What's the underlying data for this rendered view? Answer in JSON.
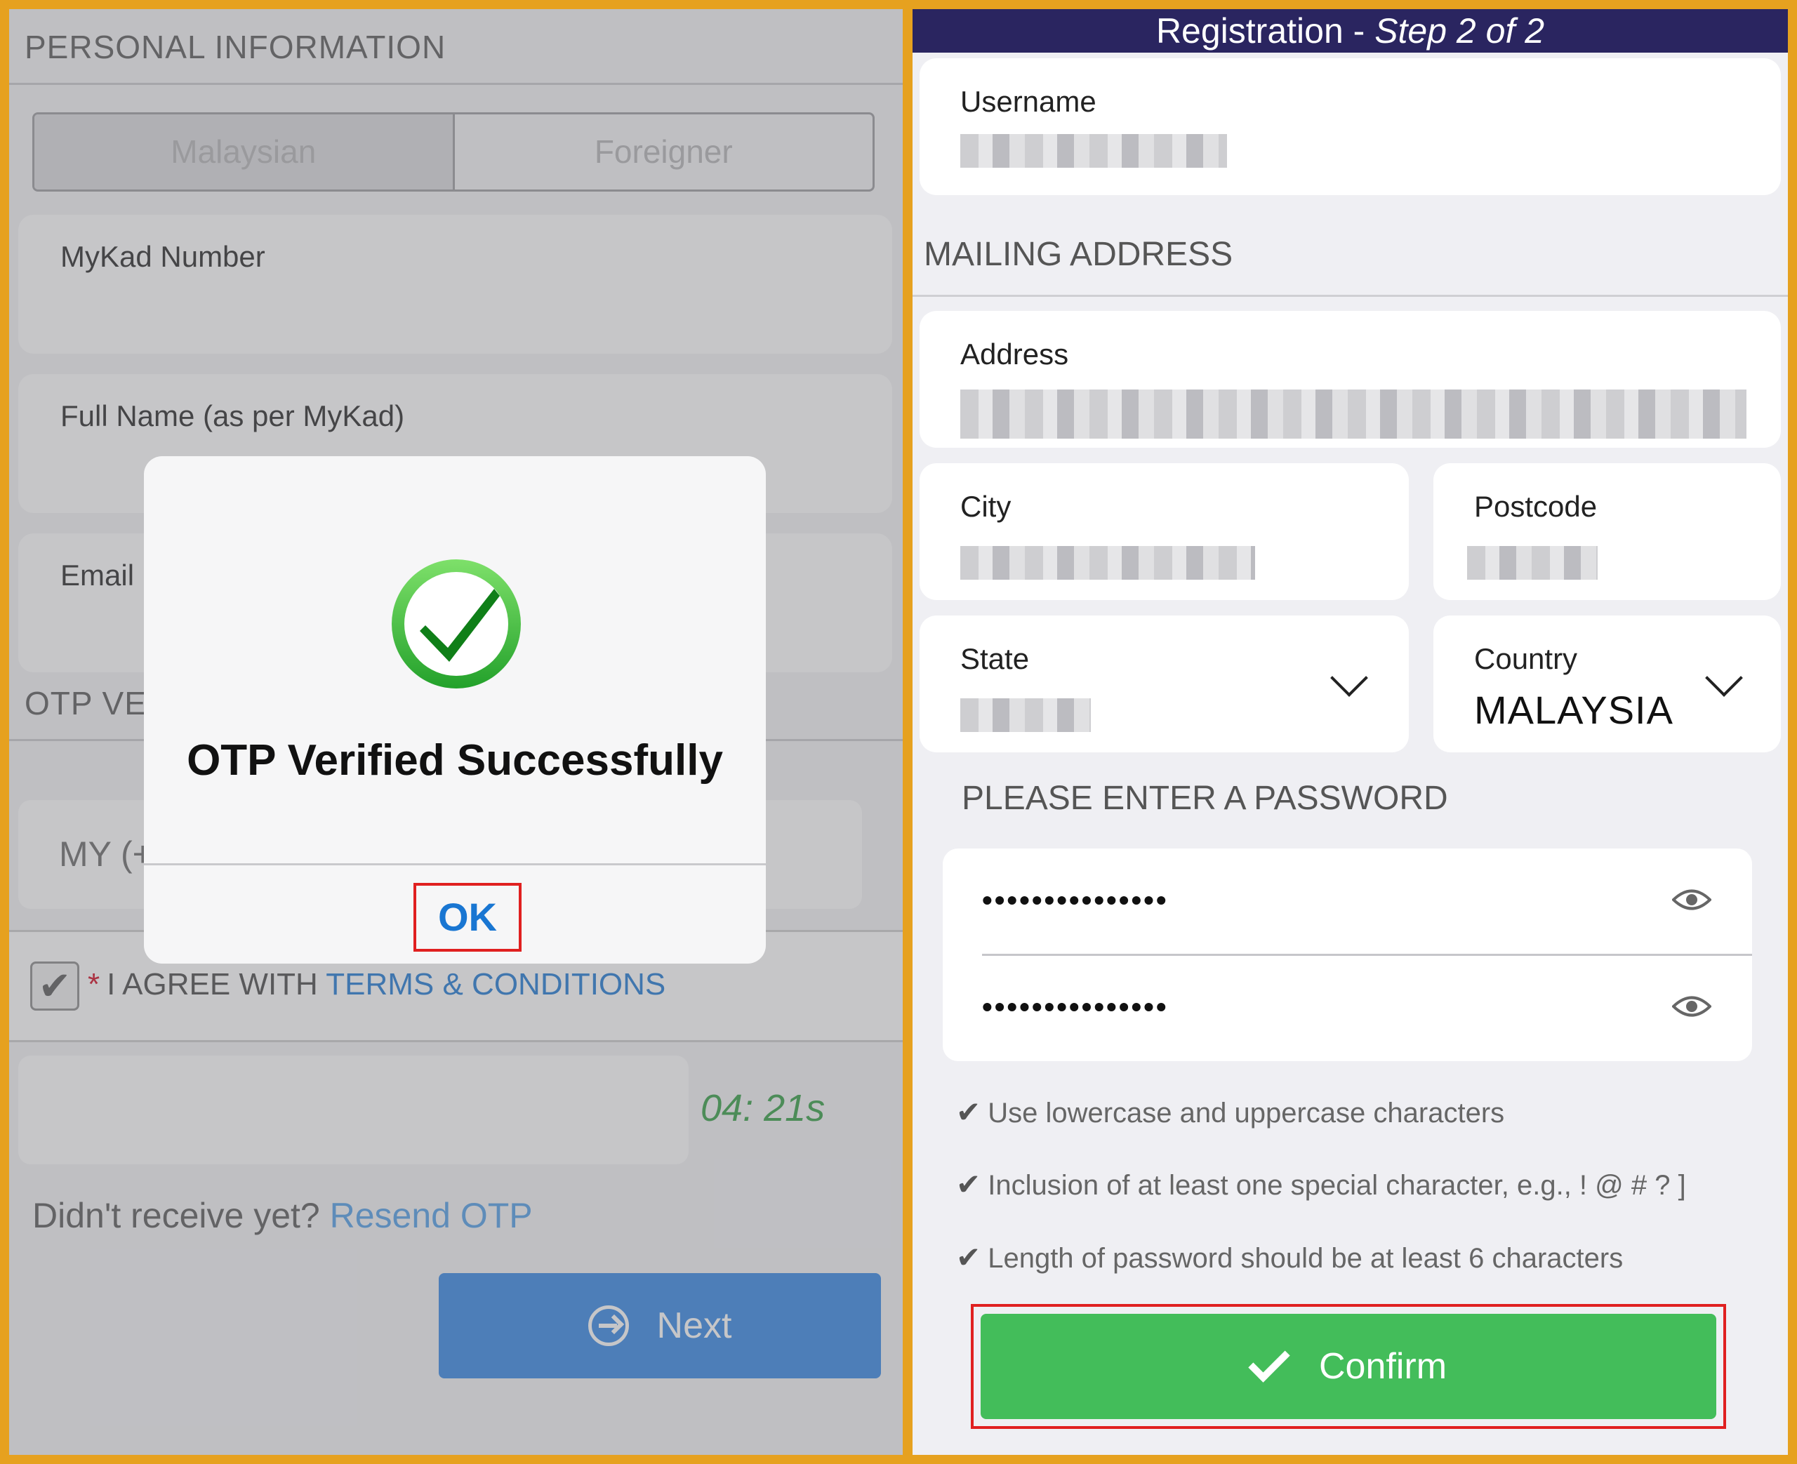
{
  "left_panel": {
    "personal_header": "PERSONAL INFORMATION",
    "tabs": [
      "Malaysian",
      "Foreigner"
    ],
    "mykad_label": "MyKad Number",
    "fullname_label": "Full Name (as per MyKad)",
    "email_label": "Email",
    "otp_header": "OTP VE",
    "phone_prefix": "MY (+",
    "agree": {
      "star": "*",
      "text": "I AGREE WITH ",
      "link": "TERMS & CONDITIONS"
    },
    "timer": "04: 21s",
    "resend_text": "Didn't receive yet? ",
    "resend_link": "Resend OTP",
    "next_button": "Next",
    "dialog": {
      "title": "OTP Verified Successfully",
      "ok": "OK",
      "icon": "check-circle-icon"
    }
  },
  "right_panel": {
    "header": {
      "title": "Registration - ",
      "step": "Step 2 of 2"
    },
    "username_label": "Username",
    "mailing_header": "MAILING ADDRESS",
    "address_label": "Address",
    "city_label": "City",
    "postcode_label": "Postcode",
    "state_label": "State",
    "country_label": "Country",
    "country_value": "MALAYSIA",
    "password_header": "PLEASE ENTER A PASSWORD",
    "password_value": "•••••••••••••••",
    "confirm_password_value": "•••••••••••••••",
    "rules": [
      "Use lowercase and uppercase characters",
      "Inclusion of at least one special character, e.g., ! @ # ? ]",
      "Length of password should be at least 6 characters"
    ],
    "confirm_button": "Confirm"
  },
  "colors": {
    "frame": "#e6a11f",
    "header_bg": "#2a2560",
    "primary_blue": "#2f84e4",
    "confirm_green": "#43bd5a",
    "highlight_red": "#e02020",
    "timer_green": "#2e9b3e"
  }
}
